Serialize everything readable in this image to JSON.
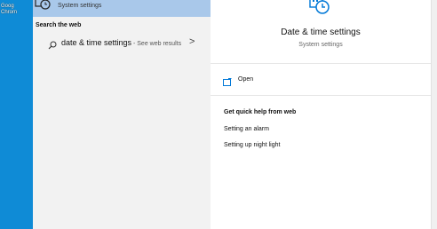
{
  "desktop": {
    "icon_label": "Goog Chrom"
  },
  "results": {
    "best_match": {
      "subtitle": "System settings",
      "icon": "calendar-clock-icon"
    },
    "search_web_heading": "Search the web",
    "web_item": {
      "query": "date & time settings",
      "hint": " - See web results",
      "arrow": ">",
      "icon": "search-icon"
    }
  },
  "preview": {
    "title": "Date & time settings",
    "subtitle": "System settings",
    "icon": "calendar-clock-icon",
    "open_label": "Open",
    "open_icon": "open-window-icon",
    "quick_help_heading": "Get quick help from web",
    "quick_links": [
      "Setting an alarm",
      "Setting up night light"
    ]
  },
  "colors": {
    "accent": "#0078d7",
    "selection": "#a9c8ea",
    "desktop": "#0f8bd6",
    "left_pane": "#f2f2f2"
  }
}
